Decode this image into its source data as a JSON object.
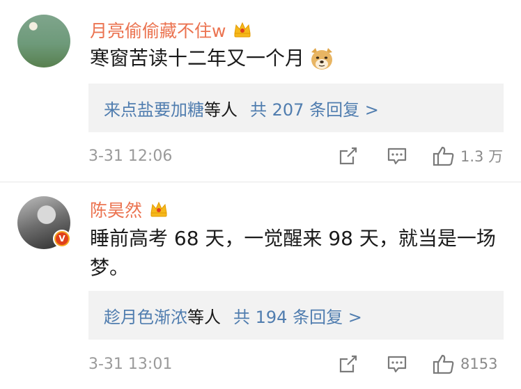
{
  "comments": [
    {
      "username": "月亮偷偷藏不住w",
      "badge_icon": "crown-badge-icon",
      "text": "寒窗苦读十二年又一个月",
      "emoji": "doge-emoji",
      "reply_names": "来点盐要加糖",
      "reply_suffix": "等人",
      "reply_total": "共 207 条回复 >",
      "time": "3-31 12:06",
      "like_count": "1.3 万"
    },
    {
      "username": "陈昊然",
      "badge_icon": "crown-badge-icon",
      "verified_badge": "V",
      "text": "睡前高考 68 天，一觉醒来 98 天，就当是一场梦。",
      "reply_names": "趁月色渐浓",
      "reply_suffix": "等人",
      "reply_total": "共 194 条回复 >",
      "time": "3-31 13:01",
      "like_count": "8153"
    }
  ],
  "colors": {
    "username": "#eb7350",
    "link": "#507daf",
    "meta": "#9a9a9a",
    "reply_bg": "#f2f2f2"
  }
}
